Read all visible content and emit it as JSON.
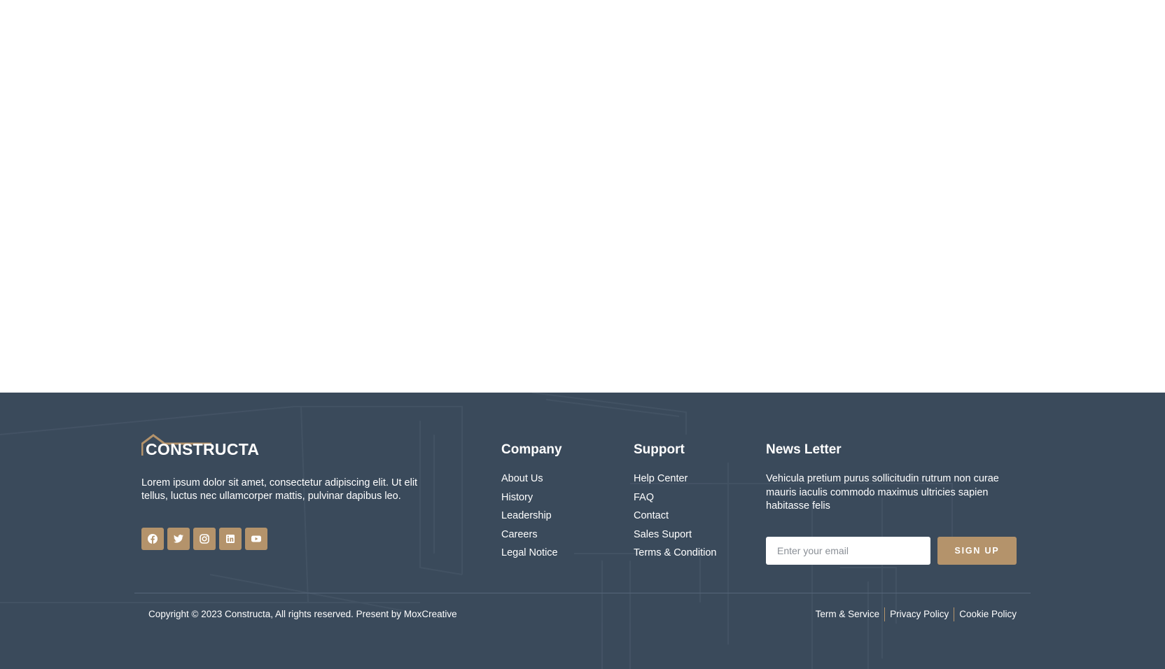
{
  "brand": {
    "name": "CONSTRUCTA",
    "about": "Lorem ipsum dolor sit amet, consectetur adipiscing elit. Ut elit tellus, luctus nec ullamcorper mattis, pulvinar dapibus leo.",
    "accent_color": "#b4936b",
    "footer_bg": "#3a4a5b"
  },
  "socials": [
    {
      "icon": "facebook-icon"
    },
    {
      "icon": "twitter-icon"
    },
    {
      "icon": "instagram-icon"
    },
    {
      "icon": "linkedin-icon"
    },
    {
      "icon": "youtube-icon"
    }
  ],
  "company": {
    "title": "Company",
    "links": [
      "About Us",
      "History",
      "Leadership",
      "Careers",
      "Legal Notice"
    ]
  },
  "support": {
    "title": "Support",
    "links": [
      "Help Center",
      "FAQ",
      "Contact",
      "Sales Suport",
      "Terms & Condition"
    ]
  },
  "newsletter": {
    "title": "News Letter",
    "text": "Vehicula pretium purus sollicitudin rutrum non curae mauris iaculis commodo maximus ultricies sapien habitasse felis",
    "email_placeholder": "Enter your email",
    "button_label": "SIGN UP"
  },
  "bottom": {
    "copyright": "Copyright © 2023 Constructa, All rights reserved. Present by MoxCreative",
    "links": [
      "Term & Service",
      "Privacy Policy",
      "Cookie Policy"
    ]
  }
}
